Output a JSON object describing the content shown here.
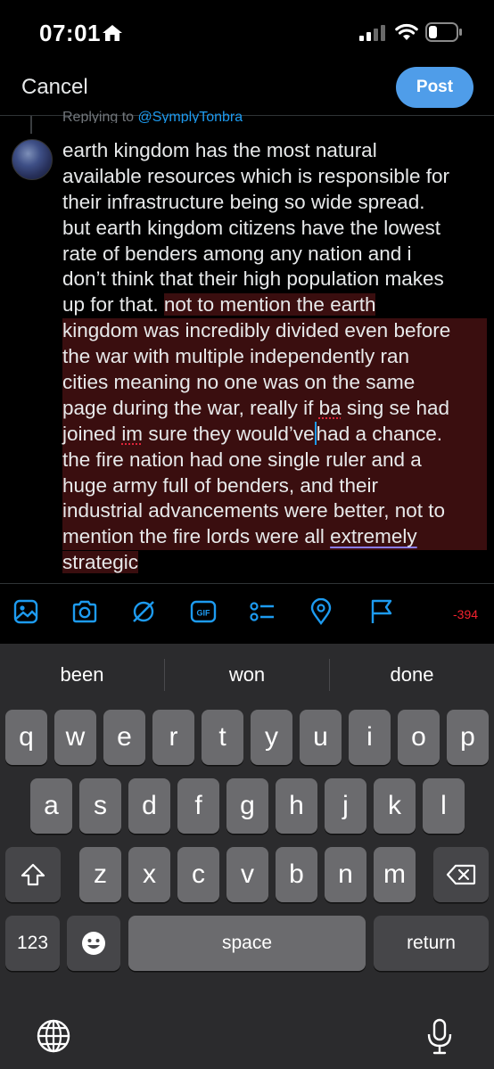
{
  "status_bar": {
    "time": "07:01"
  },
  "header": {
    "cancel_label": "Cancel",
    "post_label": "Post"
  },
  "reply": {
    "prefix": "Replying to ",
    "handle": "@SymplyTonbra"
  },
  "tweet_lines": [
    "earth kingdom has the most natural",
    "available resources which is responsible for",
    "their infrastructure being so wide spread.",
    "but earth kingdom citizens have the lowest",
    "rate of benders among any nation and i",
    "don’t think that their high population makes",
    "up for that. not to mention the earth",
    "kingdom was incredibly divided even before",
    "the war with multiple independently ran",
    "cities meaning no one was on the same",
    "page during the war, really if ba sing se had",
    "joined im sure they would’ve had a chance.",
    "the fire nation had one single ruler and a",
    "huge army full of benders, and their",
    "industrial advancements were better, not to",
    "mention the fire lords were all extremely",
    "strategic"
  ],
  "tweet_segments": {
    "l7_a": "up for that. ",
    "l7_b": "not to mention the earth",
    "l11_a": "page during the war, really if ",
    "l11_b": "ba",
    "l11_c": " sing se had",
    "l12_a": "joined ",
    "l12_b": "im",
    "l12_c": " sure they would’ve",
    "l12_d": "had a chance.",
    "l16_a": "mention the fire lords were all ",
    "l16_b": "extremely",
    "l17": "strategic "
  },
  "toolbar": {
    "icons": [
      "image-icon",
      "camera-icon",
      "grok-icon",
      "gif-icon",
      "poll-icon",
      "location-icon",
      "flag-icon"
    ],
    "gif_label": "GIF",
    "char_count": "-394"
  },
  "colors": {
    "accent": "#1d9bf0",
    "post_button": "#4f9de9",
    "over_limit": "#f4212e",
    "highlight": "#3a0e0f"
  },
  "keyboard": {
    "suggestions": [
      "been",
      "won",
      "done"
    ],
    "row1": [
      "q",
      "w",
      "e",
      "r",
      "t",
      "y",
      "u",
      "i",
      "o",
      "p"
    ],
    "row2": [
      "a",
      "s",
      "d",
      "f",
      "g",
      "h",
      "j",
      "k",
      "l"
    ],
    "row3": [
      "z",
      "x",
      "c",
      "v",
      "b",
      "n",
      "m"
    ],
    "numbers_label": "123",
    "space_label": "space",
    "return_label": "return"
  }
}
